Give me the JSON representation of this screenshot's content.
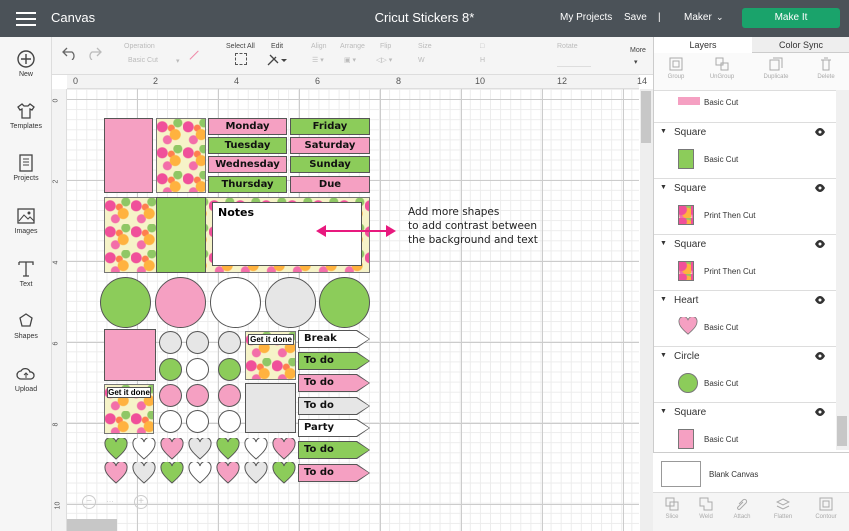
{
  "topbar": {
    "menu_icon": "hamburger-icon",
    "canvas_label": "Canvas",
    "doc_title": "Cricut Stickers 8*",
    "my_projects": "My Projects",
    "save": "Save",
    "separator": "|",
    "machine": "Maker",
    "make_it": "Make It"
  },
  "leftbar": {
    "items": [
      {
        "label": "New",
        "icon": "plus-circle-icon"
      },
      {
        "label": "Templates",
        "icon": "shirt-icon"
      },
      {
        "label": "Projects",
        "icon": "book-icon"
      },
      {
        "label": "Images",
        "icon": "image-icon"
      },
      {
        "label": "Text",
        "icon": "text-icon"
      },
      {
        "label": "Shapes",
        "icon": "shapes-icon"
      },
      {
        "label": "Upload",
        "icon": "upload-icon"
      }
    ]
  },
  "toolbar": {
    "operation_label": "Operation",
    "operation_value": "Basic Cut",
    "select_all": "Select All",
    "edit": "Edit",
    "align": "Align",
    "arrange": "Arrange",
    "flip": "Flip",
    "size": "Size",
    "size_w": "W",
    "size_h": "H",
    "rotate": "Rotate",
    "more": "More"
  },
  "ruler": {
    "top_ticks": [
      "0",
      "2",
      "4",
      "6",
      "8",
      "10",
      "12",
      "14"
    ],
    "left_ticks": [
      "0",
      "2",
      "4",
      "6",
      "8",
      "10"
    ]
  },
  "canvas": {
    "days": [
      "Monday",
      "Friday",
      "Tuesday",
      "Saturday",
      "Wednesday",
      "Sunday",
      "Thursday",
      "Due"
    ],
    "notes": "Notes",
    "get_it_done_1": "Get it done",
    "get_it_done_2": "Get it done",
    "tags": [
      "Break",
      "To do",
      "To do",
      "To do",
      "Party",
      "To do",
      "To do"
    ],
    "annotation": [
      "Add more shapes",
      "to add contrast between",
      "the background and text"
    ],
    "colors": {
      "pink": "#f5a0c2",
      "green": "#8ccc5a",
      "gray": "#e6e6e6",
      "accent_arrow": "#e8197e"
    }
  },
  "panel": {
    "tabs": [
      "Layers",
      "Color Sync"
    ],
    "tools": [
      "Group",
      "UnGroup",
      "Duplicate",
      "Delete"
    ],
    "layers": [
      {
        "name": "",
        "label": "Basic Cut"
      },
      {
        "name": "Square",
        "label": "Basic Cut"
      },
      {
        "name": "Square",
        "label": "Print Then Cut"
      },
      {
        "name": "Square",
        "label": "Print Then Cut"
      },
      {
        "name": "Heart",
        "label": "Basic Cut"
      },
      {
        "name": "Circle",
        "label": "Basic Cut"
      },
      {
        "name": "Square",
        "label": "Basic Cut"
      }
    ],
    "blank_canvas": "Blank Canvas",
    "bottom_tools": [
      "Slice",
      "Weld",
      "Attach",
      "Flatten",
      "Contour"
    ]
  }
}
